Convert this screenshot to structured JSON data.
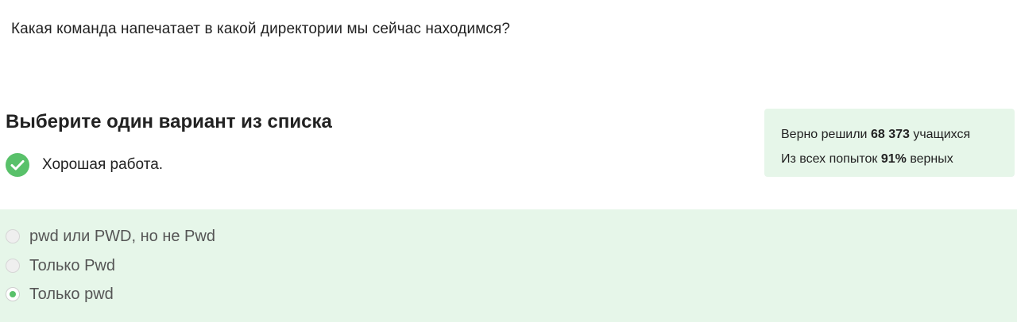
{
  "question": {
    "text": "Какая команда напечатает в какой директории мы сейчас находимся?"
  },
  "section": {
    "title": "Выберите один вариант из списка"
  },
  "feedback": {
    "icon": "check-circle-icon",
    "text": "Хорошая работа."
  },
  "stats": {
    "solved_prefix": "Верно решили",
    "solved_count": "68 373",
    "solved_suffix": "учащихся",
    "attempts_prefix": "Из всех попыток",
    "attempts_percent": "91%",
    "attempts_suffix": "верных"
  },
  "options": [
    {
      "label": "pwd или PWD, но не Pwd",
      "selected": false
    },
    {
      "label": "Только Pwd",
      "selected": false
    },
    {
      "label": "Только pwd",
      "selected": true
    }
  ],
  "colors": {
    "success_green": "#59c16a",
    "light_green_bg": "#e6f6e9"
  }
}
